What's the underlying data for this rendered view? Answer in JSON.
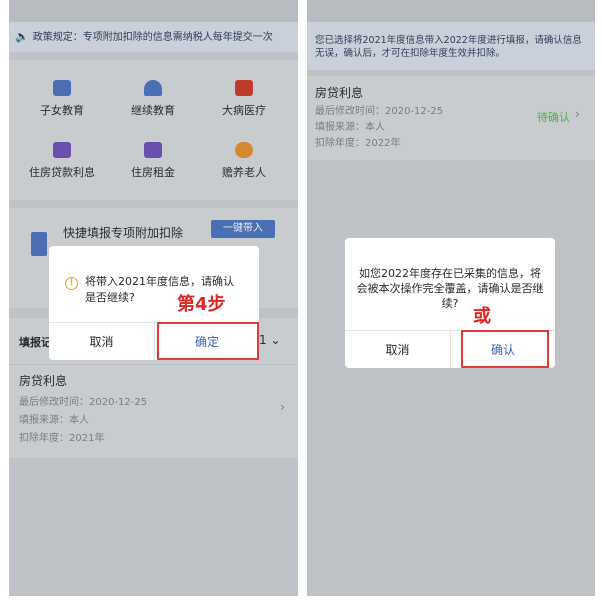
{
  "left": {
    "notice": "政策规定：专项附加扣除的信息需纳税人每年提交一次",
    "categories": [
      {
        "label": "子女教育",
        "icon": "children-education-icon",
        "color": "#4a6fb4"
      },
      {
        "label": "继续教育",
        "icon": "graduation-cap-icon",
        "color": "#4a6fb4"
      },
      {
        "label": "大病医疗",
        "icon": "medical-kit-icon",
        "color": "#c0392b"
      },
      {
        "label": "住房贷款利息",
        "icon": "house-loan-icon",
        "color": "#6a4fb0"
      },
      {
        "label": "住房租金",
        "icon": "house-rent-icon",
        "color": "#6a4fb0"
      },
      {
        "label": "赡养老人",
        "icon": "elderly-person-icon",
        "color": "#d48a2c"
      }
    ],
    "quick_fill_title": "快捷填报专项附加扣除",
    "one_click_button": "一键带入",
    "section_header": "填报记",
    "section_suffix": "1",
    "record": {
      "title": "房贷利息",
      "modified": "最后修改时间：2020-12-25",
      "source": "填报来源：本人",
      "year": "扣除年度：2021年"
    },
    "dialog": {
      "message": "将带入2021年度信息，请确认是否继续?",
      "cancel": "取消",
      "confirm": "确定",
      "annotation": "第4步"
    }
  },
  "right": {
    "notice": "您已选择将2021年度信息带入2022年度进行填报，请确认信息无误，确认后，才可在扣除年度生效并扣除。",
    "record": {
      "title": "房贷利息",
      "modified": "最后修改时间：2020-12-25",
      "source": "填报来源：本人",
      "year": "扣除年度：2022年",
      "status": "待确认"
    },
    "dialog": {
      "message": "如您2022年度存在已采集的信息，将会被本次操作完全覆盖，请确认是否继续?",
      "cancel": "取消",
      "confirm": "确认",
      "annotation": "或"
    }
  },
  "colors": {
    "annotation_red": "#e02626",
    "link_blue": "#3a64b8",
    "status_green": "#4caf50"
  }
}
